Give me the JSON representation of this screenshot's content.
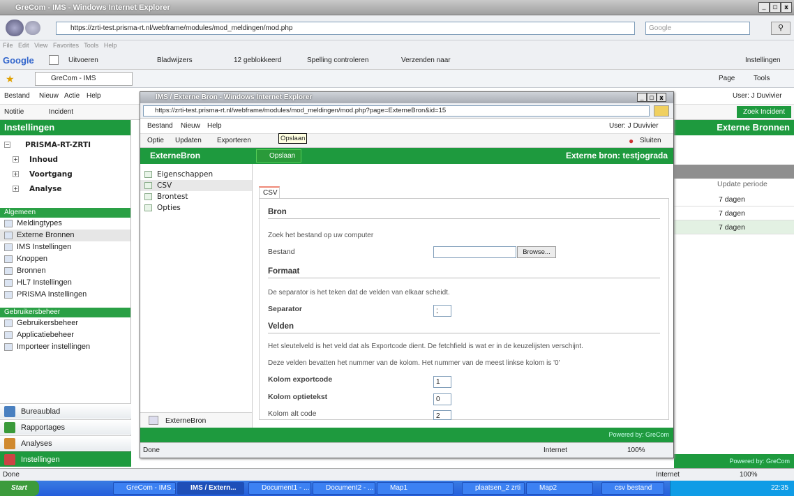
{
  "ie": {
    "title": "GreCom - IMS - Windows Internet Explorer",
    "url": "https://zrti-test.prisma-rt.nl/webframe/modules/mod_meldingen/mod.php",
    "search_placeholder": "Google",
    "menu": [
      "File",
      "Edit",
      "View",
      "Favorites",
      "Tools",
      "Help"
    ],
    "google_toolbar": [
      "Uitvoeren",
      "Bladwijzers",
      "12 geblokkeerd",
      "Spelling controleren",
      "Verzenden naar",
      "Instellingen"
    ],
    "tab": "GreCom - IMS",
    "page_tools": [
      "Page",
      "Tools"
    ]
  },
  "app": {
    "menu": [
      "Bestand",
      "Nieuw",
      "Actie",
      "Help"
    ],
    "user": "User: J Duvivier",
    "toolbar": [
      "Notitie",
      "Incident"
    ],
    "search_button": "Zoek Incident",
    "sidebar_title": "Instellingen",
    "right_title": "Externe Bronnen",
    "tree_root": "PRISMA-RT-ZRTI",
    "tree_items": [
      "Inhoud",
      "Voortgang",
      "Analyse"
    ],
    "section_algemeen": "Algemeen",
    "algemeen_items": [
      "Meldingtypes",
      "Externe Bronnen",
      "IMS Instellingen",
      "Knoppen",
      "Bronnen",
      "HL7 Instellingen",
      "PRISMA Instellingen"
    ],
    "section_gebruikers": "Gebruikersbeheer",
    "gebruikers_items": [
      "Gebruikersbeheer",
      "Applicatiebeheer",
      "Importeer instellingen"
    ],
    "bottom_buttons": [
      "Bureaublad",
      "Rapportages",
      "Analyses",
      "Instellingen"
    ],
    "table_header": "Update periode",
    "table_values": [
      "7 dagen",
      "7 dagen",
      "7 dagen"
    ],
    "powered": "Powered by: GreCom",
    "status": "Done",
    "zone": "Internet",
    "zoom": "100%"
  },
  "popup": {
    "title": "IMS / Externe Bron - Windows Internet Explorer",
    "url": "https://zrti-test.prisma-rt.nl/webframe/modules/mod_meldingen/mod.php?page=ExterneBron&id=15",
    "menu": [
      "Bestand",
      "Nieuw",
      "Help"
    ],
    "user": "User: J Duvivier",
    "toolbar": [
      "Optie",
      "Updaten",
      "Exporteren"
    ],
    "close": "Sluiten",
    "left_title": "ExterneBron",
    "save": "Opslaan",
    "tooltip": "Opslaan",
    "header_right": "Externe bron: testjograda",
    "nav": [
      "Eigenschappen",
      "CSV",
      "Brontest",
      "Opties"
    ],
    "bottom_item": "ExterneBron",
    "tab": "CSV",
    "bron_title": "Bron",
    "bron_text": "Zoek het bestand op uw computer",
    "bestand_label": "Bestand",
    "browse": "Browse...",
    "formaat_title": "Formaat",
    "formaat_text": "De separator is het teken dat de velden van elkaar scheidt.",
    "separator_label": "Separator",
    "separator_value": ";",
    "velden_title": "Velden",
    "velden_text1": "Het sleutelveld is het veld dat als Exportcode dient. De fetchfield is wat er in de keuzelijsten verschijnt.",
    "velden_text2": "Deze velden bevatten het nummer van de kolom. Het nummer van de meest linkse kolom is '0'",
    "kolom_export_label": "Kolom exportcode",
    "kolom_export_value": "1",
    "kolom_optie_label": "Kolom optietekst",
    "kolom_optie_value": "0",
    "kolom_alt_label": "Kolom alt code",
    "kolom_alt_value": "2",
    "powered": "Powered by: GreCom",
    "status": "Done",
    "zone": "Internet",
    "zoom": "100%"
  },
  "taskbar": {
    "start": "Start",
    "items": [
      "GreCom - IMS ...",
      "IMS / Extern...",
      "Document1 - ...",
      "Document2 - ...",
      "Map1",
      "plaatsen_2 zrti",
      "Map2",
      "csv bestand"
    ],
    "clock": "22:35"
  }
}
